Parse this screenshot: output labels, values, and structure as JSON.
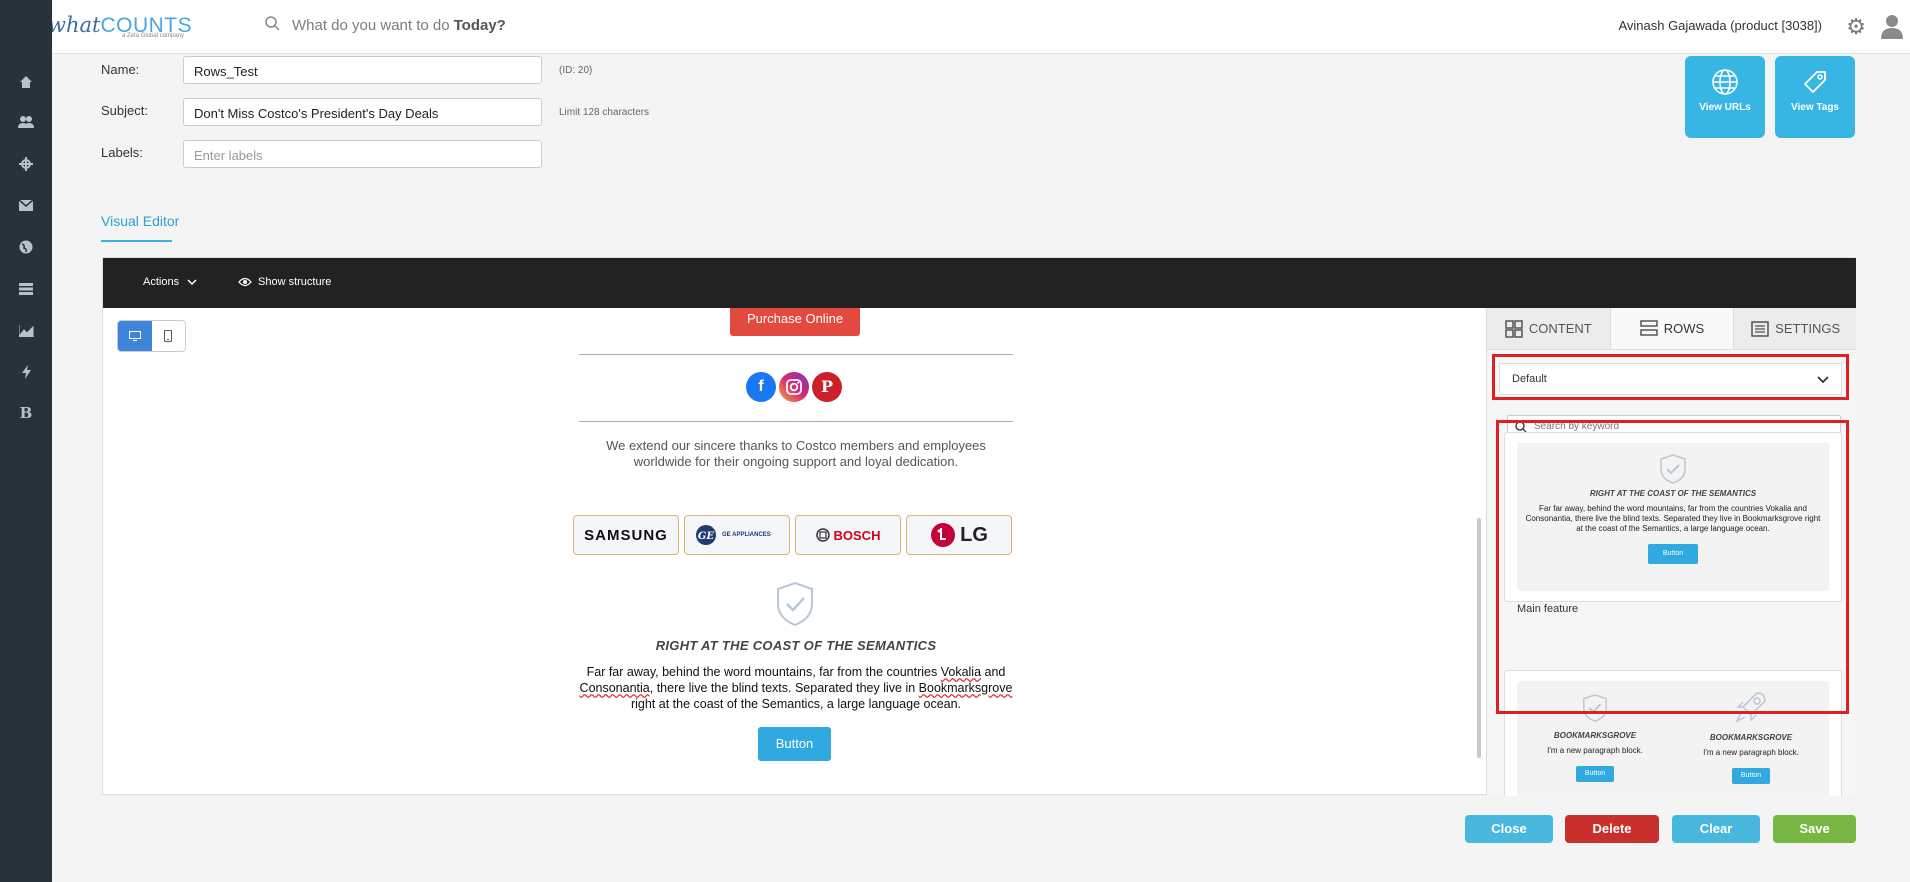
{
  "app": {
    "brand_what": "what",
    "brand_counts": "COUNTS",
    "brand_sub": "a Zeta Global company"
  },
  "header": {
    "search_placeholder": "What do you want to do",
    "search_today": "Today?",
    "user": "Avinash Gajawada (product [3038])"
  },
  "sidebar": {
    "items": [
      "home-icon",
      "users-icon",
      "crosshair-icon",
      "mail-icon",
      "globe-icon",
      "list-icon",
      "chart-icon",
      "bolt-icon",
      "b-icon"
    ],
    "last_letter": "B"
  },
  "form": {
    "name_label": "Name:",
    "name_value": "Rows_Test",
    "name_id": "(ID: 20)",
    "subject_label": "Subject:",
    "subject_value": "Don't Miss Costco's President's Day Deals",
    "subject_hint": "Limit 128 characters",
    "labels_label": "Labels:",
    "labels_placeholder": "Enter labels"
  },
  "tiles": {
    "view_urls": "View URLs",
    "view_tags": "View Tags"
  },
  "tabs": {
    "visual_editor": "Visual Editor"
  },
  "editor": {
    "actions": "Actions",
    "show_structure": "Show structure",
    "purchase": "Purchase Online",
    "thanks": "We extend our sincere thanks to Costco members and employees worldwide for their ongoing support and loyal dedication.",
    "brands": [
      "SAMSUNG",
      "GE APPLIANCES",
      "BOSCH",
      "LG"
    ],
    "section_title": "RIGHT AT THE COAST OF THE SEMANTICS",
    "body_1": "Far far away, behind the word mountains, far from the countries ",
    "body_vokalia": "Vokalia",
    "body_2": " and ",
    "body_conson": "Consonantia",
    "body_3": ", there live the blind texts. Separated they live in ",
    "body_bookmarks": "Bookmarksgrove",
    "body_4": " right at the coast of the Semantics, a large language ocean.",
    "button": "Button"
  },
  "panel": {
    "tabs": [
      "CONTENT",
      "ROWS",
      "SETTINGS"
    ],
    "category": "Default",
    "search_placeholder": "Search by keyword",
    "card1": {
      "title": "RIGHT AT THE COAST OF THE SEMANTICS",
      "body": "Far far away, behind the word mountains, far from the countries Vokalia and Consonantia, there live the blind texts. Separated they live in Bookmarksgrove right at the coast of the Semantics, a large language ocean.",
      "button": "Button",
      "caption": "Main feature"
    },
    "card2": {
      "col_title": "BOOKMARKSGROVE",
      "col_body": "I'm a new paragraph block.",
      "button": "Button"
    }
  },
  "footer": {
    "close": "Close",
    "delete": "Delete",
    "clear": "Clear",
    "save": "Save"
  },
  "colors": {
    "accent": "#37b5e3",
    "sidebar": "#27323b",
    "danger": "#c9302c",
    "success": "#78b743",
    "highlight": "#e02020"
  }
}
